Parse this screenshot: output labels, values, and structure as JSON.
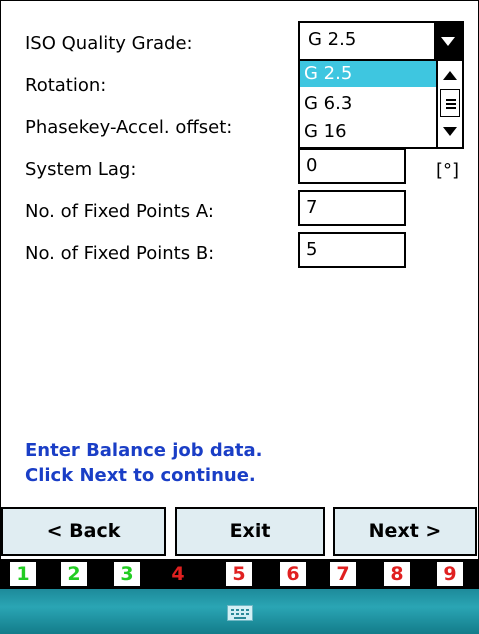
{
  "form": {
    "iso_label": "ISO Quality Grade:",
    "rotation_label": "Rotation:",
    "phasekey_label": "Phasekey-Accel. offset:",
    "system_lag_label": "System Lag:",
    "system_lag_value": "0",
    "system_lag_unit": "[°]",
    "fixed_a_label": "No. of Fixed Points A:",
    "fixed_a_value": "7",
    "fixed_b_label": "No. of Fixed Points B:",
    "fixed_b_value": "5"
  },
  "iso_dropdown": {
    "selected": "G 2.5",
    "options": [
      "G 2.5",
      "G 6.3",
      "G 16"
    ],
    "highlighted_index": 0
  },
  "message": {
    "line1": "Enter Balance job data.",
    "line2": "Click Next to continue."
  },
  "buttons": {
    "back": "< Back",
    "exit": "Exit",
    "next": "Next >"
  },
  "steps": [
    {
      "label": "1",
      "color": "#22cc22"
    },
    {
      "label": "2",
      "color": "#22cc22"
    },
    {
      "label": "3",
      "color": "#22cc22"
    },
    {
      "label": "4",
      "color": "#e02020",
      "current": true
    },
    {
      "label": "5",
      "color": "#e02020"
    },
    {
      "label": "6",
      "color": "#e02020"
    },
    {
      "label": "7",
      "color": "#e02020"
    },
    {
      "label": "8",
      "color": "#e02020"
    },
    {
      "label": "9",
      "color": "#e02020"
    }
  ],
  "taskbar": {
    "icon": "keyboard-icon"
  }
}
